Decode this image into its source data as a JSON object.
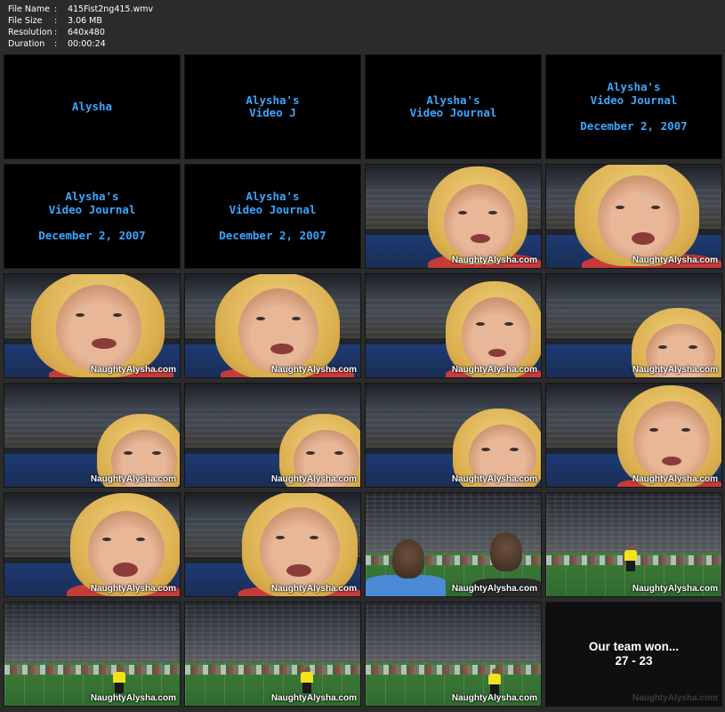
{
  "file_info": [
    {
      "label": "File Name",
      "sep": ":",
      "value": "415Fist2ng415.wmv"
    },
    {
      "label": "File Size",
      "sep": ":",
      "value": "3.06 MB"
    },
    {
      "label": "Resolution",
      "sep": ":",
      "value": "640x480"
    },
    {
      "label": "Duration",
      "sep": ":",
      "value": "00:00:24"
    }
  ],
  "watermark": "NaughtyAlysha.com",
  "titles": {
    "t1": "Alysha",
    "t2": "Alysha's\nVideo J",
    "t3": "Alysha's\nVideo Journal",
    "t4": "Alysha's\nVideo Journal\n\nDecember 2, 2007"
  },
  "final": {
    "line1": "Our team won...",
    "line2": "27 - 23"
  },
  "colors": {
    "background": "#2b2b2b",
    "title_text": "#3aa6ff",
    "info_text": "#ffffff"
  }
}
